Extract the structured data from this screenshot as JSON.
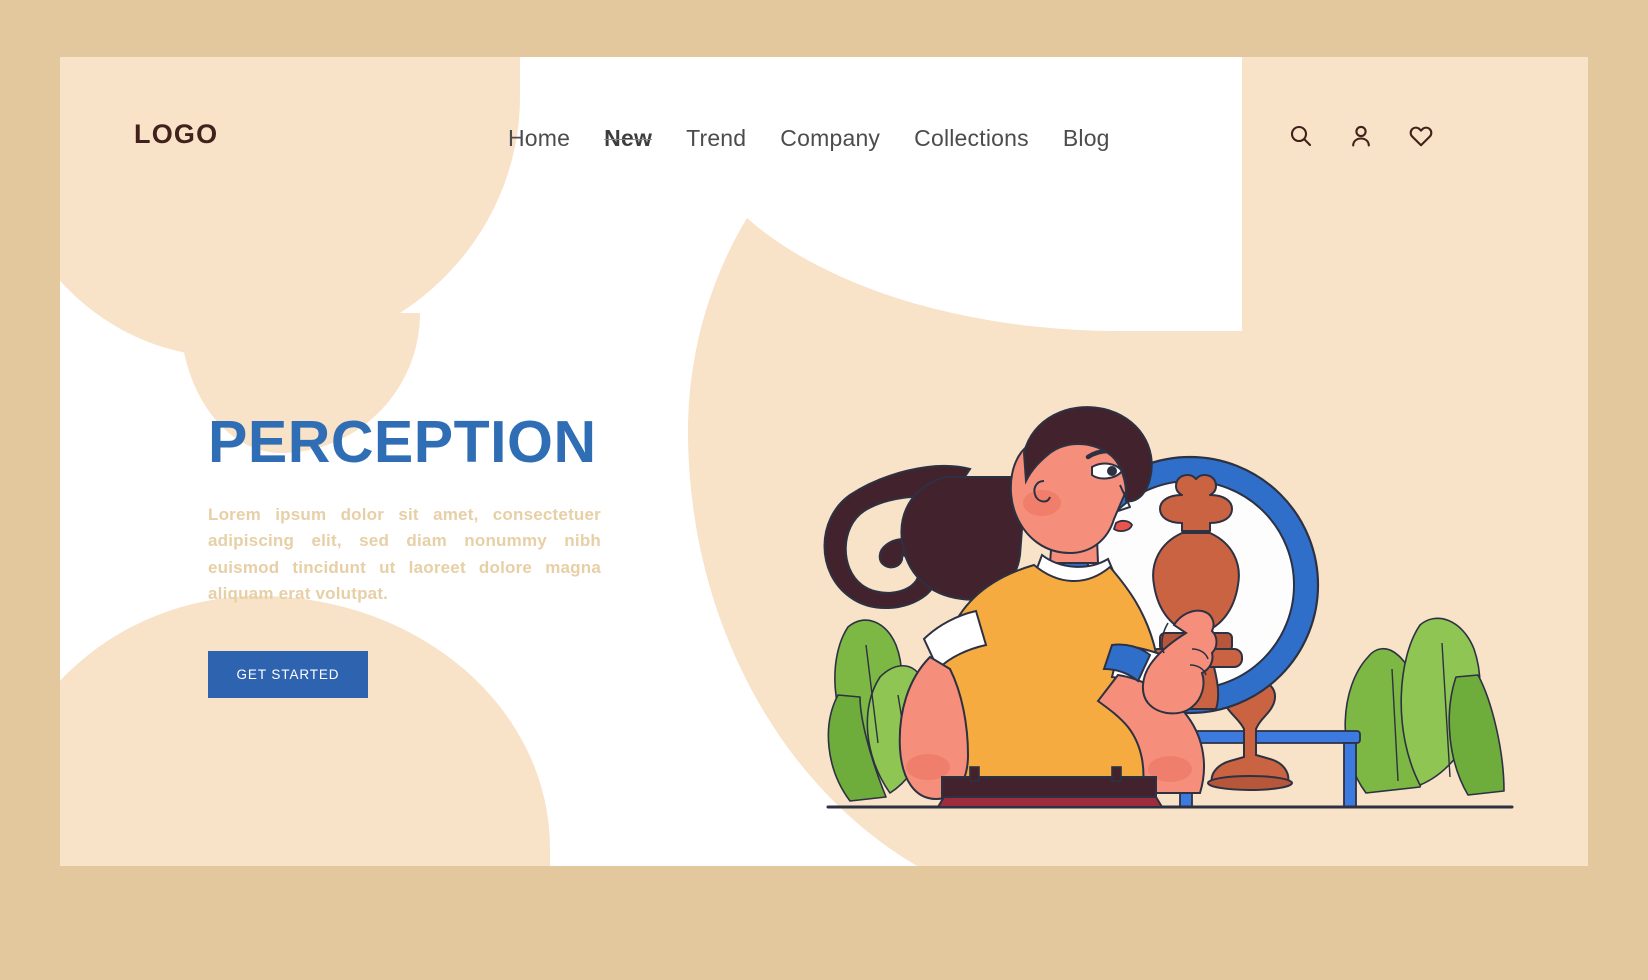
{
  "brand": {
    "logo": "LOGO"
  },
  "nav": {
    "items": [
      {
        "label": "Home",
        "active": false
      },
      {
        "label": "New",
        "active": true
      },
      {
        "label": "Trend",
        "active": false
      },
      {
        "label": "Company",
        "active": false
      },
      {
        "label": "Collections",
        "active": false
      },
      {
        "label": "Blog",
        "active": false
      }
    ]
  },
  "header_icons": [
    {
      "name": "search-icon",
      "label": "Search"
    },
    {
      "name": "user-icon",
      "label": "Account"
    },
    {
      "name": "heart-icon",
      "label": "Favorites"
    }
  ],
  "hero": {
    "title": "PERCEPTION",
    "paragraph": "Lorem ipsum dolor sit amet, consectetuer adipiscing elit, sed diam nonummy nibh euismod tincidunt ut laoreet dolore magna aliquam erat volutpat.",
    "cta_label": "GET STARTED"
  },
  "illustration": {
    "alt": "Woman looking at a chess king piece reflected in a round hand mirror",
    "elements": [
      "woman-figure",
      "ponytail-hair",
      "yellow-blouse",
      "maroon-skirt",
      "round-mirror",
      "chess-king-piece",
      "blue-side-table",
      "green-leaves",
      "floor-line"
    ]
  },
  "colors": {
    "page_border": "#e3c79d",
    "card_background": "#ffffff",
    "blob_peach": "#f8e2c8",
    "accent_blue": "#2f6db5",
    "button_blue": "#2e63b0",
    "paragraph_tan": "#e7cfa6",
    "logo_brown": "#40211c",
    "nav_gray": "#4c4c4c",
    "skin": "#f58f7b",
    "hair_brown": "#42222c",
    "blouse_yellow": "#f6ab40",
    "skirt_maroon": "#9e2c3f",
    "mirror_blue": "#2f6fc9",
    "table_blue": "#3d7ae0",
    "chess_terracotta": "#c96342",
    "leaf_green": "#7cb843"
  }
}
